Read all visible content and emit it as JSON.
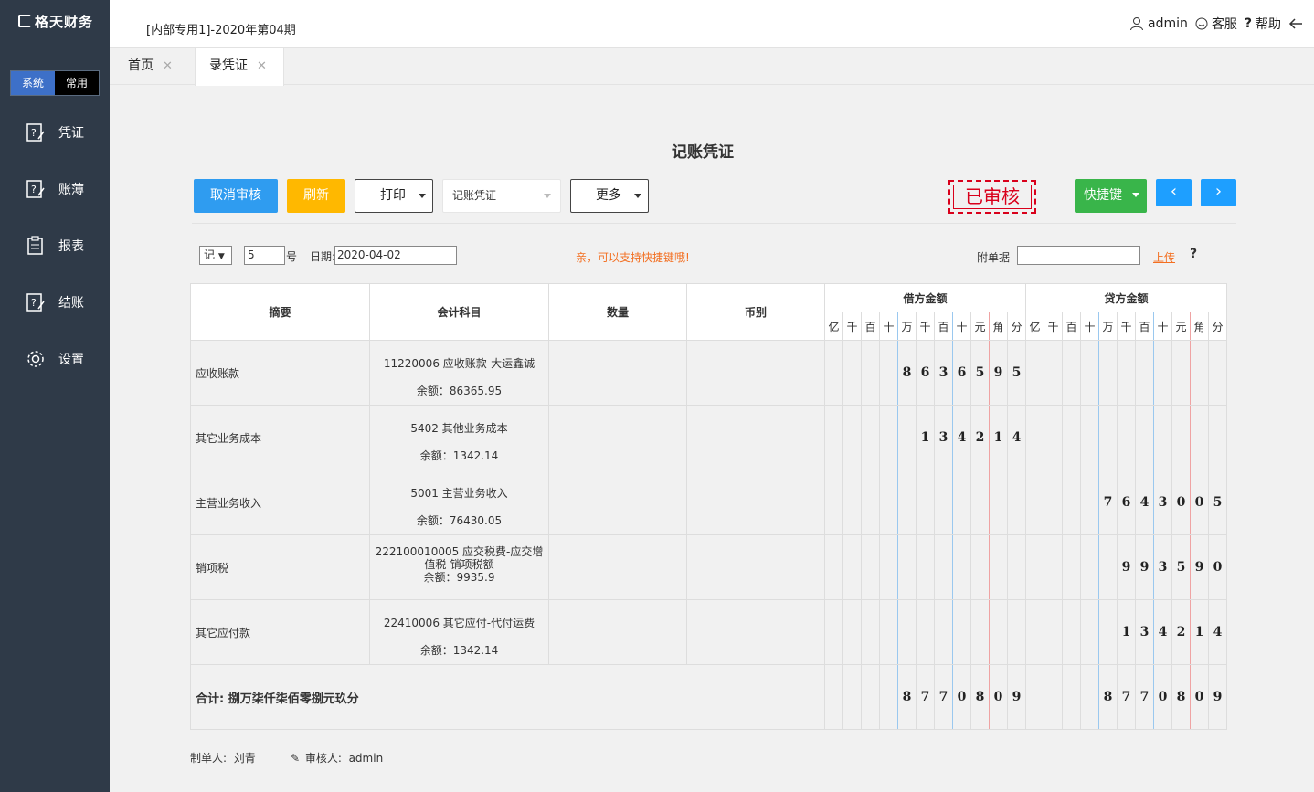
{
  "app": {
    "logo": "格天财务"
  },
  "mode_switch": {
    "system": "系统",
    "common": "常用"
  },
  "sidebar": {
    "items": [
      {
        "label": "凭证",
        "icon": "voucher-icon"
      },
      {
        "label": "账薄",
        "icon": "ledger-icon"
      },
      {
        "label": "报表",
        "icon": "report-icon"
      },
      {
        "label": "结账",
        "icon": "close-account-icon"
      },
      {
        "label": "设置",
        "icon": "gear-icon"
      }
    ]
  },
  "header": {
    "period": "[内部专用1]-2020年第04期",
    "user": "admin",
    "service": "客服",
    "help": "帮助"
  },
  "tabs": [
    {
      "label": "首页"
    },
    {
      "label": "录凭证"
    }
  ],
  "page": {
    "title": "记账凭证"
  },
  "toolbar": {
    "cancel_audit": "取消审核",
    "refresh": "刷新",
    "print": "打印",
    "voucher_type": "记账凭证",
    "more": "更多",
    "audit_stamp": "已审核",
    "shortcut": "快捷键",
    "prev": "‹",
    "next": "›"
  },
  "form": {
    "word": "记",
    "voucher_no": "5",
    "no_suffix": "号",
    "date_label": "日期:",
    "date": "2020-04-02",
    "tip": "亲，可以支持快捷键哦!",
    "attach_label": "附单据",
    "attach_value": "",
    "upload": "上传",
    "help": "?"
  },
  "table": {
    "headers": {
      "summary": "摘要",
      "account": "会计科目",
      "quantity": "数量",
      "currency": "币别",
      "debit": "借方金额",
      "credit": "贷方金额"
    },
    "digit_units": [
      "亿",
      "千",
      "百",
      "十",
      "万",
      "千",
      "百",
      "十",
      "元",
      "角",
      "分"
    ],
    "rows": [
      {
        "summary": "应收账款",
        "account": "11220006 应收账款-大运鑫诚",
        "balance": "余额：86365.95",
        "debit": [
          "",
          "",
          "",
          "",
          "8",
          "6",
          "3",
          "6",
          "5",
          "9",
          "5"
        ],
        "credit": [
          "",
          "",
          "",
          "",
          "",
          "",
          "",
          "",
          "",
          "",
          ""
        ]
      },
      {
        "summary": "其它业务成本",
        "account": "5402 其他业务成本",
        "balance": "余额：1342.14",
        "debit": [
          "",
          "",
          "",
          "",
          "",
          "1",
          "3",
          "4",
          "2",
          "1",
          "4"
        ],
        "credit": [
          "",
          "",
          "",
          "",
          "",
          "",
          "",
          "",
          "",
          "",
          ""
        ]
      },
      {
        "summary": "主营业务收入",
        "account": "5001 主营业务收入",
        "balance": "余额：76430.05",
        "debit": [
          "",
          "",
          "",
          "",
          "",
          "",
          "",
          "",
          "",
          "",
          ""
        ],
        "credit": [
          "",
          "",
          "",
          "",
          "7",
          "6",
          "4",
          "3",
          "0",
          "0",
          "5"
        ]
      },
      {
        "summary": "销项税",
        "account": "222100010005 应交税费-应交增值税-销项税额",
        "balance": "余额：9935.9",
        "debit": [
          "",
          "",
          "",
          "",
          "",
          "",
          "",
          "",
          "",
          "",
          ""
        ],
        "credit": [
          "",
          "",
          "",
          "",
          "",
          "9",
          "9",
          "3",
          "5",
          "9",
          "0"
        ]
      },
      {
        "summary": "其它应付款",
        "account": "22410006 其它应付-代付运费",
        "balance": "余额：1342.14",
        "debit": [
          "",
          "",
          "",
          "",
          "",
          "",
          "",
          "",
          "",
          "",
          ""
        ],
        "credit": [
          "",
          "",
          "",
          "",
          "",
          "1",
          "3",
          "4",
          "2",
          "1",
          "4"
        ]
      }
    ],
    "total": {
      "label": "合计: 捌万柒仟柒佰零捌元玖分",
      "debit": [
        "",
        "",
        "",
        "",
        "8",
        "7",
        "7",
        "0",
        "8",
        "0",
        "9"
      ],
      "credit": [
        "",
        "",
        "",
        "",
        "8",
        "7",
        "7",
        "0",
        "8",
        "0",
        "9"
      ]
    }
  },
  "footer": {
    "maker_label": "制单人:",
    "maker": "刘青",
    "auditor_label": "审核人:",
    "auditor": "admin"
  }
}
